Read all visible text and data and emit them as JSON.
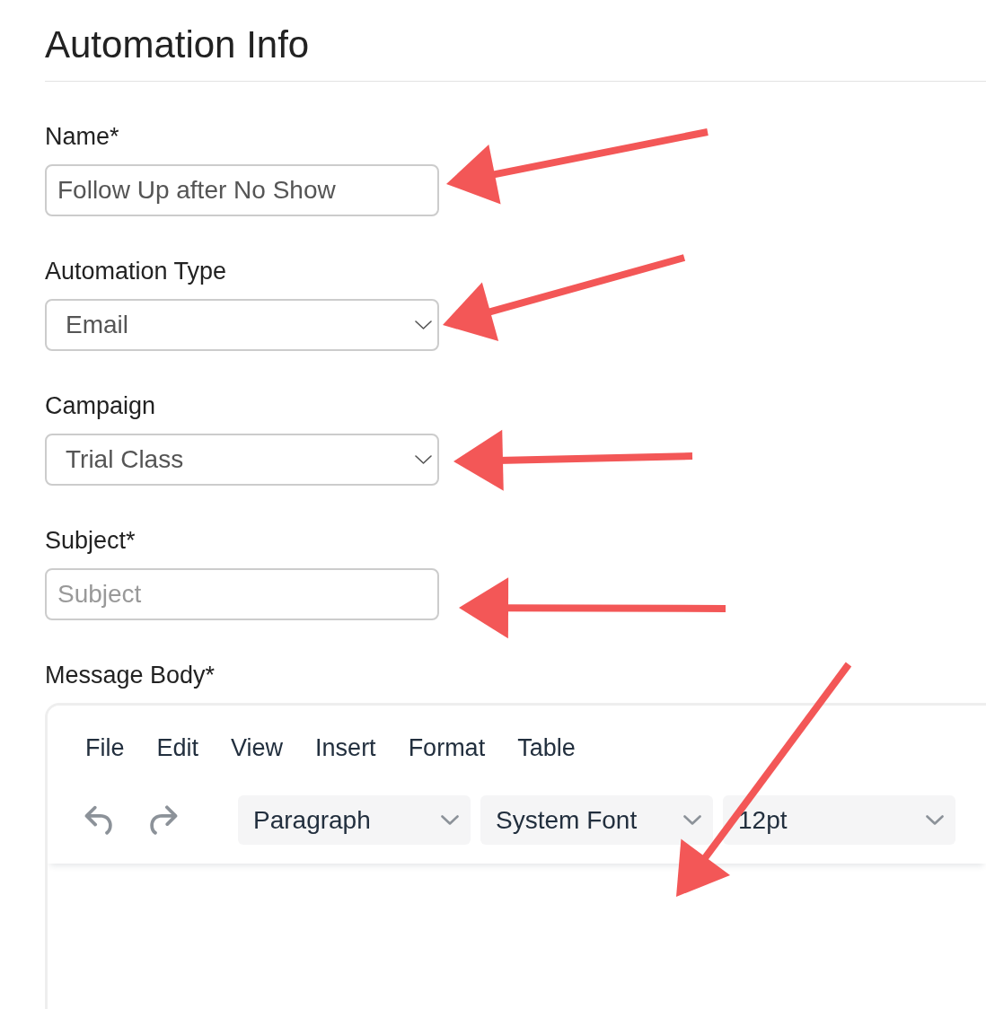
{
  "page": {
    "title": "Automation Info"
  },
  "fields": [
    {
      "kind": "text",
      "label": "Name*",
      "value": "Follow Up after No Show"
    },
    {
      "kind": "select",
      "label": "Automation Type",
      "value": "Email"
    },
    {
      "kind": "select",
      "label": "Campaign",
      "value": "Trial Class"
    },
    {
      "kind": "text",
      "label": "Subject*",
      "placeholder": "Subject"
    }
  ],
  "message_body": {
    "label": "Message Body*",
    "menubar": [
      "File",
      "Edit",
      "View",
      "Insert",
      "Format",
      "Table"
    ],
    "history_buttons": [
      {
        "kind": "undo",
        "disabled": true
      },
      {
        "kind": "redo",
        "disabled": true
      }
    ],
    "dropdowns": [
      {
        "value": "Paragraph"
      },
      {
        "value": "System Font"
      },
      {
        "value": "12pt"
      }
    ]
  }
}
